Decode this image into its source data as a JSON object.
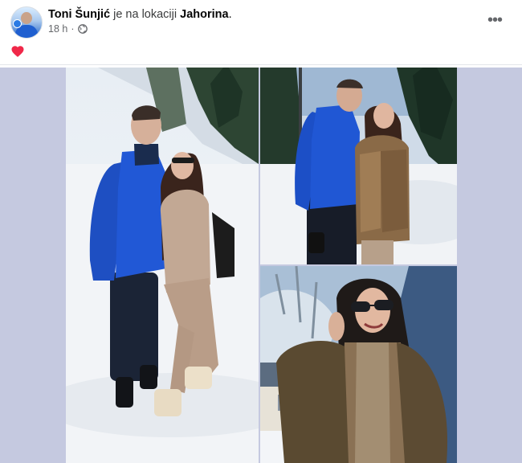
{
  "post": {
    "author_name": "Toni Šunjić",
    "location_connector": "je na lokaciji",
    "location_name": "Jahorina",
    "location_suffix": ".",
    "timestamp": "18 h",
    "separator": "·",
    "privacy_icon": "globe-icon",
    "more_icon": "more-options-icon",
    "more_label": "•••",
    "reaction_icon": "heart-icon",
    "heart_color": "#f02849"
  },
  "gallery": {
    "photos": [
      {
        "id": "photo-1",
        "subject": "couple standing in snow"
      },
      {
        "id": "photo-2",
        "subject": "couple among snowy pines"
      },
      {
        "id": "photo-3",
        "subject": "woman in fur coat and sunglasses"
      }
    ]
  },
  "colors": {
    "gallery_background": "#c5c9e0",
    "text_primary": "#050505",
    "text_secondary": "#65676b"
  }
}
